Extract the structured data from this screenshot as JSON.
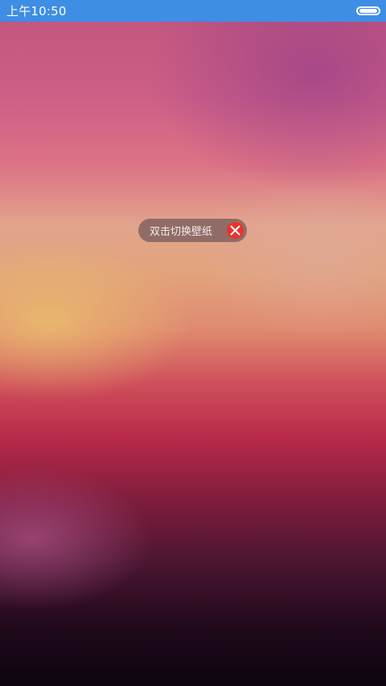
{
  "status_bar": {
    "time": "上午10:50",
    "background_color": "#3d8ee4",
    "battery_icon": "battery-icon"
  },
  "toast": {
    "text": "双击切换壁纸",
    "close_icon": "close-icon",
    "close_color": "#e8332d"
  }
}
